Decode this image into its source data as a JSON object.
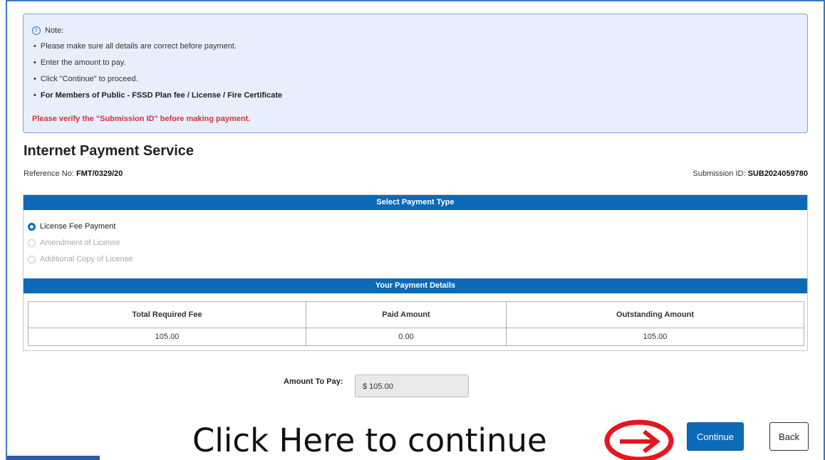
{
  "note": {
    "title": "Note:",
    "items": [
      "Please make sure all details are correct before payment.",
      "Enter the amount to pay.",
      "Click \"Continue\" to proceed.",
      "For Members of Public - FSSD Plan fee / License / Fire Certificate"
    ],
    "warning": "Please verify the \"Submission ID\" before making payment."
  },
  "page": {
    "title": "Internet Payment Service",
    "reference_label": "Reference No:",
    "reference_value": "FMT/0329/20",
    "submission_label": "Submission ID:",
    "submission_value": "SUB2024059780"
  },
  "payment_type": {
    "header": "Select Payment Type",
    "options": [
      {
        "label": "License Fee Payment",
        "selected": true,
        "enabled": true
      },
      {
        "label": "Amendment of License",
        "selected": false,
        "enabled": false
      },
      {
        "label": "Additional Copy of License",
        "selected": false,
        "enabled": false
      }
    ]
  },
  "payment_details": {
    "header": "Your Payment Details",
    "columns": [
      "Total Required Fee",
      "Paid Amount",
      "Outstanding Amount"
    ],
    "values": [
      "105.00",
      "0.00",
      "105.00"
    ]
  },
  "amount": {
    "label": "Amount To Pay:",
    "value": "$ 105.00"
  },
  "overlay": {
    "text": "Click Here to continue"
  },
  "buttons": {
    "continue_label": "Continue",
    "back_label": "Back"
  },
  "colors": {
    "primary": "#0c6ab8",
    "warning": "#d0343f",
    "note_bg": "#e8eefb",
    "annotation": "#e8141e"
  }
}
